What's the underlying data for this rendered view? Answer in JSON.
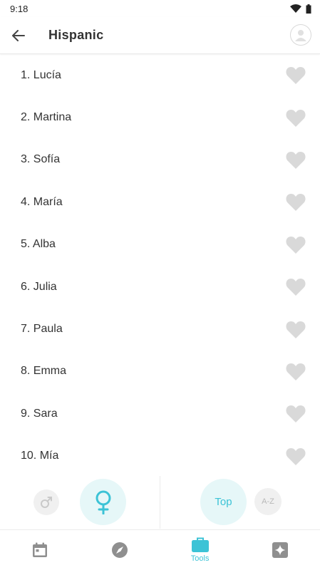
{
  "status": {
    "time": "9:18"
  },
  "header": {
    "title": "Hispanic"
  },
  "names": [
    {
      "label": "1. Lucía"
    },
    {
      "label": "2. Martina"
    },
    {
      "label": "3. Sofía"
    },
    {
      "label": "4. María"
    },
    {
      "label": "5. Alba"
    },
    {
      "label": "6. Julia"
    },
    {
      "label": "7. Paula"
    },
    {
      "label": "8. Emma"
    },
    {
      "label": "9. Sara"
    },
    {
      "label": "10. Mía"
    }
  ],
  "filters": {
    "gender_selected": "female",
    "sort_top_label": "Top",
    "sort_az_label": "A-Z",
    "sort_selected": "top"
  },
  "bottom_nav": {
    "items": [
      {
        "icon": "calendar-icon"
      },
      {
        "icon": "compass-icon"
      },
      {
        "icon": "toolbox-icon",
        "label": "Tools",
        "active": true
      },
      {
        "icon": "sparkle-icon"
      }
    ]
  },
  "colors": {
    "accent": "#3cc3d6",
    "accent_bg": "#e6f7f8",
    "heart_inactive": "#d9d9d9",
    "inactive_icon": "#8f8f8f"
  }
}
